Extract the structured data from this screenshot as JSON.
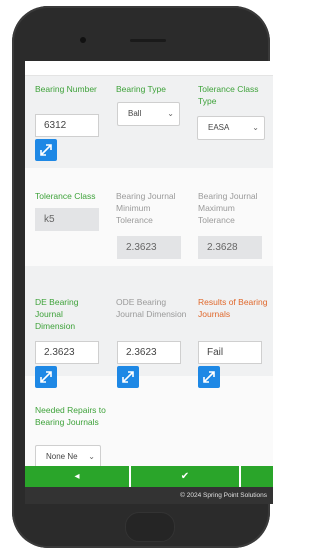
{
  "form": {
    "bearing_number": {
      "label": "Bearing Number",
      "value": "6312"
    },
    "bearing_type": {
      "label": "Bearing Type",
      "value": "Ball"
    },
    "tolerance_class_type": {
      "label": "Tolerance Class Type",
      "value": "EASA"
    },
    "tolerance_class": {
      "label": "Tolerance Class",
      "value": "k5"
    },
    "journal_min": {
      "label": "Bearing Journal Minimum Tolerance",
      "value": "2.3623"
    },
    "journal_max": {
      "label": "Bearing Journal Maximum Tolerance",
      "value": "2.3628"
    },
    "de_journal": {
      "label": "DE Bearing Journal Dimension",
      "value": "2.3623"
    },
    "ode_journal": {
      "label": "ODE Bearing Journal Dimension",
      "value": "2.3623"
    },
    "results": {
      "label": "Results of Bearing Journals",
      "value": "Fail"
    },
    "needed_repairs": {
      "label": "Needed Repairs to Bearing Journals",
      "value": "None Ne"
    }
  },
  "footer": {
    "prev_glyph": "◂",
    "check_glyph": "✔",
    "copyright": "© 2024 Spring Point Solutions"
  },
  "colors": {
    "accent_green": "#3ea23a",
    "button_green": "#2aa52a",
    "fail_orange": "#e0682b",
    "expand_blue": "#1e88e5"
  },
  "icons": [
    "expand-icon",
    "chevron-down-icon",
    "arrow-left-icon",
    "check-icon"
  ]
}
